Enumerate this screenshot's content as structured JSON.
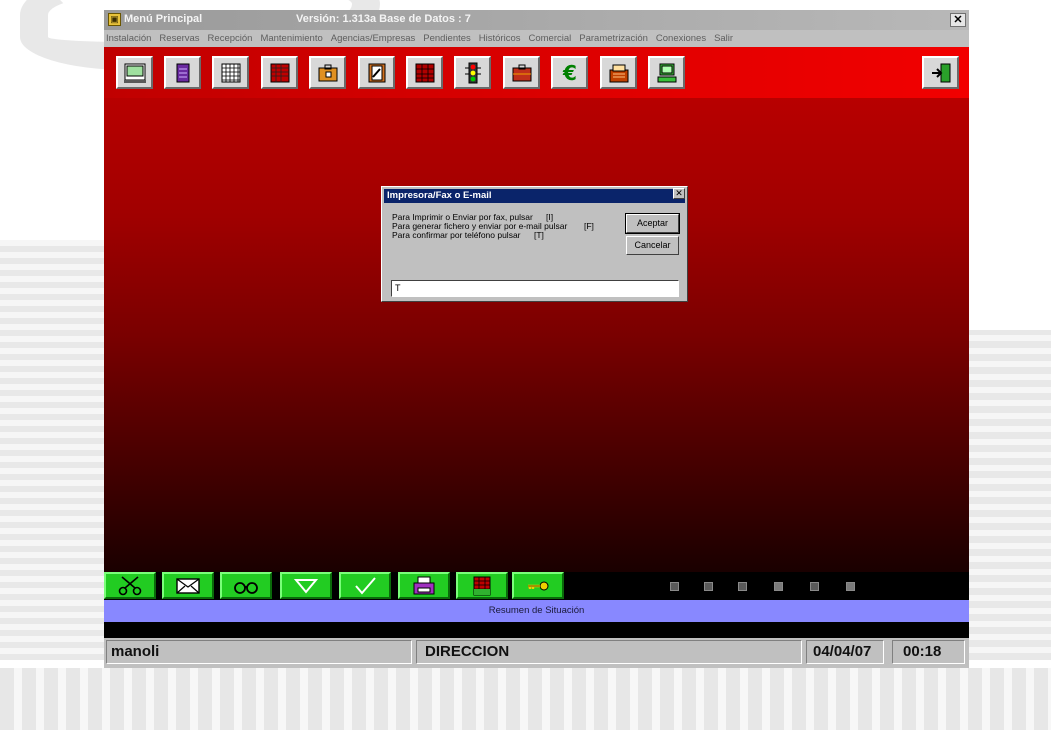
{
  "window": {
    "title": "Menú Principal",
    "version": "Versión: 1.313a Base de Datos : 7"
  },
  "menu": [
    "Instalación",
    "Reservas",
    "Recepción",
    "Mantenimiento",
    "Agencias/Empresas",
    "Pendientes",
    "Históricos",
    "Comercial",
    "Parametrización",
    "Conexiones",
    "Salir"
  ],
  "toolbar": {
    "buttons": [
      "picture-icon",
      "list-icon",
      "grid-icon",
      "ledger-icon",
      "briefcase-icon",
      "notebook-icon",
      "table-icon",
      "traffic-light-icon",
      "suitcase-icon",
      "euro-icon",
      "cash-register-icon",
      "computer-icon"
    ],
    "exit": "exit-door-icon",
    "euro_symbol": "€"
  },
  "dialog": {
    "title": "Impresora/Fax o E-mail",
    "line1": "Para Imprimir o Enviar por fax, pulsar",
    "key1": "[I]",
    "line2": "Para generar fichero y enviar por e-mail pulsar",
    "key2": "[F]",
    "line3": "Para confirmar por teléfono pulsar",
    "key3": "[T]",
    "ok_label": "Aceptar",
    "cancel_label": "Cancelar",
    "input_value": "T",
    "close_glyph": "✕"
  },
  "actions": [
    "scissors-icon",
    "envelope-icon",
    "binoculars-icon",
    "triangle-down-icon",
    "checkmark-icon",
    "printer-icon",
    "spreadsheet-icon",
    "key-icon"
  ],
  "checkboxes": [
    false,
    false,
    false,
    true,
    false,
    true
  ],
  "summary_label": "Resumen de Situación",
  "status": {
    "user": "manoli",
    "department": "DIRECCION",
    "date": "04/04/07",
    "time": "00:18"
  },
  "colors": {
    "toolbar_red": "#e00000",
    "action_green": "#22cc22",
    "summary_blue": "#8888ff",
    "dialog_title": "#0a246a"
  }
}
